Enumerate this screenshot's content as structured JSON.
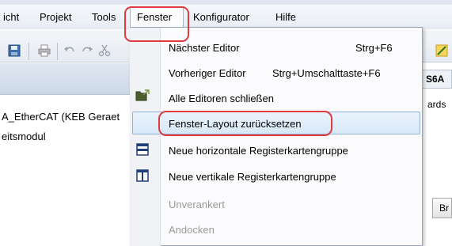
{
  "menubar": {
    "items": [
      {
        "label": "icht"
      },
      {
        "label": "Projekt"
      },
      {
        "label": "Tools"
      },
      {
        "label": "Fenster"
      },
      {
        "label": "Konfigurator"
      },
      {
        "label": "Hilfe"
      }
    ]
  },
  "toolbar": {
    "icons": [
      "save-icon",
      "print-icon",
      "undo-icon",
      "redo-icon",
      "cut-icon"
    ]
  },
  "workspace": {
    "tree": {
      "device_label": "A_EtherCAT (KEB Geraet",
      "module_label": "eitsmodul"
    }
  },
  "editor": {
    "tab_label": "S6A",
    "sub_label": "ards",
    "button_label": "Br"
  },
  "fenster_menu": {
    "items": [
      {
        "label": "Nächster Editor",
        "shortcut": "Strg+F6",
        "enabled": true
      },
      {
        "label": "Vorheriger Editor",
        "shortcut": "Strg+Umschalttaste+F6",
        "enabled": true
      },
      {
        "label": "Alle Editoren schließen",
        "shortcut": "",
        "enabled": true,
        "icon": "close-editors-icon"
      },
      {
        "label": "Fenster-Layout zurücksetzen",
        "shortcut": "",
        "enabled": true,
        "selected": true
      },
      {
        "label": "Neue horizontale Registerkartengruppe",
        "shortcut": "",
        "enabled": true,
        "icon": "horizontal-tab-group-icon"
      },
      {
        "label": "Neue vertikale Registerkartengruppe",
        "shortcut": "",
        "enabled": true,
        "icon": "vertical-tab-group-icon"
      },
      {
        "label": "Unverankert",
        "shortcut": "",
        "enabled": false
      },
      {
        "label": "Andocken",
        "shortcut": "",
        "enabled": false
      }
    ]
  },
  "colors": {
    "highlight_outline": "#e0393e",
    "selection_fill": "#d8e8f8",
    "menu_bg": "#fbfbfd"
  }
}
